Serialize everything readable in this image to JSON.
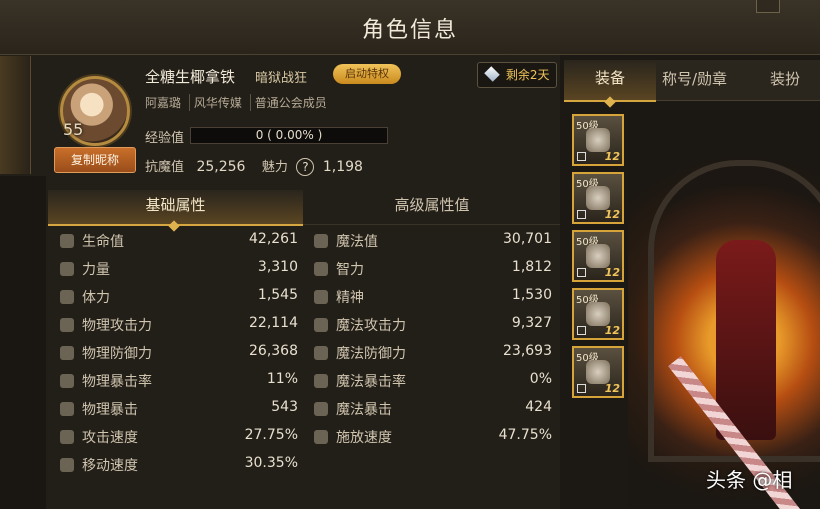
{
  "window": {
    "title": "角色信息"
  },
  "profile": {
    "level": "55",
    "name": "全糖生椰拿铁",
    "job": "暗狱战狂",
    "privilege_button": "启动特权",
    "tags": [
      "阿嘉璐",
      "风华传媒",
      "普通公会成员"
    ],
    "copy_button": "复制昵称",
    "exp_label": "经验值",
    "exp_text": "0 ( 0.00% )",
    "exp_fraction": 0,
    "resist_label": "抗魔值",
    "resist_value": "25,256",
    "charm_label": "魅力",
    "charm_value": "1,198",
    "help_glyph": "?"
  },
  "remaining": {
    "text": "剩余2天",
    "icon": "diamond-icon"
  },
  "stat_tabs": [
    "基础属性",
    "高级属性值"
  ],
  "stats": [
    {
      "left_label": "生命值",
      "left_value": "42,261",
      "left_icon": "heart-icon",
      "right_label": "魔法值",
      "right_value": "30,701",
      "right_icon": "heart-outline-icon"
    },
    {
      "left_label": "力量",
      "left_value": "3,310",
      "left_icon": "arm-icon",
      "right_label": "智力",
      "right_value": "1,812",
      "right_icon": "crossed-wands-icon"
    },
    {
      "left_label": "体力",
      "left_value": "1,545",
      "left_icon": "body-icon",
      "right_label": "精神",
      "right_value": "1,530",
      "right_icon": "orb-icon"
    },
    {
      "left_label": "物理攻击力",
      "left_value": "22,114",
      "left_icon": "sword-icon",
      "right_label": "魔法攻击力",
      "right_value": "9,327",
      "right_icon": "magic-burst-icon"
    },
    {
      "left_label": "物理防御力",
      "left_value": "26,368",
      "left_icon": "shield-icon",
      "right_label": "魔法防御力",
      "right_value": "23,693",
      "right_icon": "yin-yang-icon"
    },
    {
      "left_label": "物理暴击率",
      "left_value": "11%",
      "left_icon": "crosshair-icon",
      "right_label": "魔法暴击率",
      "right_value": "0%",
      "right_icon": "orb-icon"
    },
    {
      "left_label": "物理暴击",
      "left_value": "543",
      "left_icon": "crosshair-icon",
      "right_label": "魔法暴击",
      "right_value": "424",
      "right_icon": "orb-icon"
    },
    {
      "left_label": "攻击速度",
      "left_value": "27.75%",
      "left_icon": "attack-speed-icon",
      "right_label": "施放速度",
      "right_value": "47.75%",
      "right_icon": "fist-icon"
    },
    {
      "left_label": "移动速度",
      "left_value": "30.35%",
      "left_icon": "boot-icon",
      "right_label": "",
      "right_value": "",
      "right_icon": ""
    }
  ],
  "right_tabs": [
    "装备",
    "称号/勋章",
    "装扮"
  ],
  "equipment_slots": [
    {
      "level": "50级",
      "quality": "12"
    },
    {
      "level": "50级",
      "quality": "12"
    },
    {
      "level": "50级",
      "quality": "12"
    },
    {
      "level": "50级",
      "quality": "12"
    },
    {
      "level": "50级",
      "quality": "12"
    }
  ],
  "watermark": "头条 @相"
}
